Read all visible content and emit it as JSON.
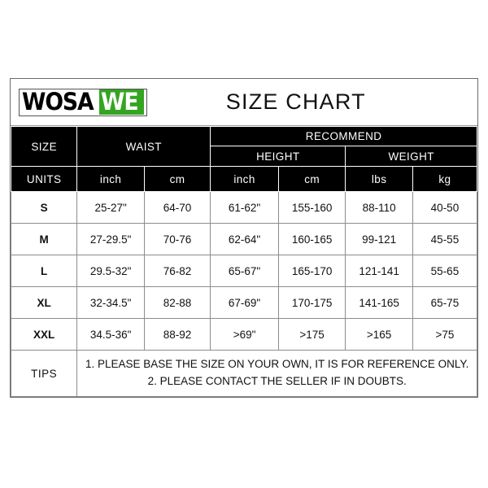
{
  "logo": {
    "part1": "WOSA",
    "part2": "WE",
    "green": "#34a521"
  },
  "title": "SIZE CHART",
  "header": {
    "size": "SIZE",
    "waist": "WAIST",
    "recommend": "RECOMMEND",
    "height": "HEIGHT",
    "weight": "WEIGHT",
    "units_label": "UNITS",
    "units": [
      "inch",
      "cm",
      "inch",
      "cm",
      "lbs",
      "kg"
    ]
  },
  "rows": [
    {
      "size": "S",
      "waist_inch": "25-27\"",
      "waist_cm": "64-70",
      "height_inch": "61-62\"",
      "height_cm": "155-160",
      "weight_lbs": "88-110",
      "weight_kg": "40-50"
    },
    {
      "size": "M",
      "waist_inch": "27-29.5\"",
      "waist_cm": "70-76",
      "height_inch": "62-64\"",
      "height_cm": "160-165",
      "weight_lbs": "99-121",
      "weight_kg": "45-55"
    },
    {
      "size": "L",
      "waist_inch": "29.5-32\"",
      "waist_cm": "76-82",
      "height_inch": "65-67\"",
      "height_cm": "165-170",
      "weight_lbs": "121-141",
      "weight_kg": "55-65"
    },
    {
      "size": "XL",
      "waist_inch": "32-34.5\"",
      "waist_cm": "82-88",
      "height_inch": "67-69\"",
      "height_cm": "170-175",
      "weight_lbs": "141-165",
      "weight_kg": "65-75"
    },
    {
      "size": "XXL",
      "waist_inch": "34.5-36\"",
      "waist_cm": "88-92",
      "height_inch": ">69\"",
      "height_cm": ">175",
      "weight_lbs": ">165",
      "weight_kg": ">75"
    }
  ],
  "tips": {
    "label": "TIPS",
    "line1": "1. PLEASE BASE THE SIZE ON YOUR OWN, IT IS FOR REFERENCE ONLY.",
    "line2": "2. PLEASE CONTACT THE SELLER IF IN DOUBTS."
  }
}
